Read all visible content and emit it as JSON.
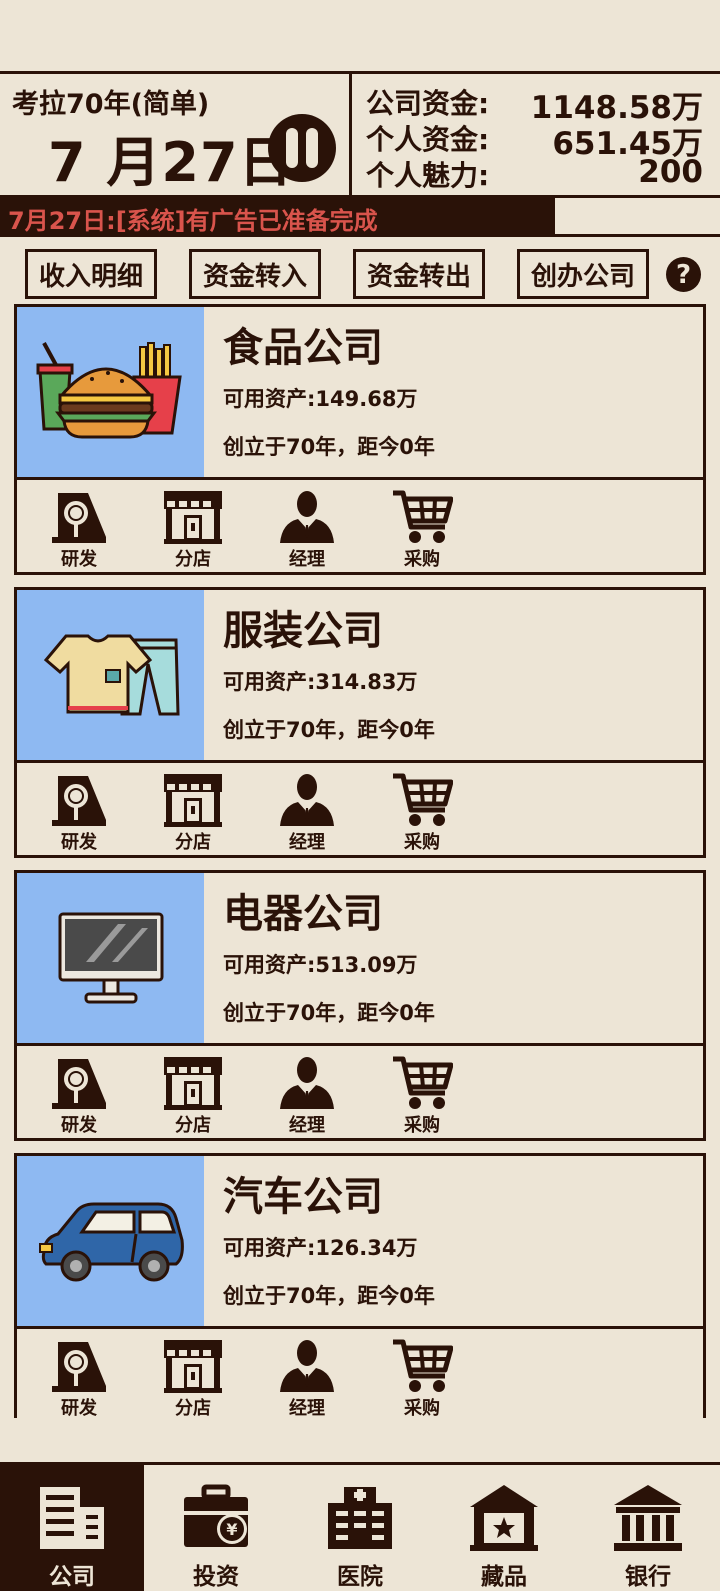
{
  "header": {
    "game_title": "考拉70年(简单)",
    "date": "7 月27日",
    "stats": [
      {
        "label": "公司资金:",
        "value": "1148.58万"
      },
      {
        "label": "个人资金:",
        "value": "651.45万"
      },
      {
        "label": "个人魅力:",
        "value": "200"
      }
    ]
  },
  "message": {
    "text": "7月27日:[系统]有广告已准备完成",
    "color": "#d9544c"
  },
  "actions": [
    {
      "label": "收入明细"
    },
    {
      "label": "资金转入"
    },
    {
      "label": "资金转出"
    },
    {
      "label": "创办公司"
    }
  ],
  "help_icon": "?",
  "card_actions": [
    "研发",
    "分店",
    "经理",
    "采购"
  ],
  "companies": [
    {
      "name": "食品公司",
      "assets": "可用资产:149.68万",
      "founded": "创立于70年，距今0年",
      "icon": "burger-fries-icon"
    },
    {
      "name": "服装公司",
      "assets": "可用资产:314.83万",
      "founded": "创立于70年，距今0年",
      "icon": "clothes-icon"
    },
    {
      "name": "电器公司",
      "assets": "可用资产:513.09万",
      "founded": "创立于70年，距今0年",
      "icon": "monitor-icon"
    },
    {
      "name": "汽车公司",
      "assets": "可用资产:126.34万",
      "founded": "创立于70年，距今0年",
      "icon": "car-icon"
    }
  ],
  "nav": [
    {
      "label": "公司",
      "active": true
    },
    {
      "label": "投资",
      "active": false
    },
    {
      "label": "医院",
      "active": false
    },
    {
      "label": "藏品",
      "active": false
    },
    {
      "label": "银行",
      "active": false
    }
  ],
  "colors": {
    "background": "#ede5d6",
    "ink": "#2a1208",
    "card_image_bg": "#8eb9f2",
    "message_text": "#d9544c"
  }
}
